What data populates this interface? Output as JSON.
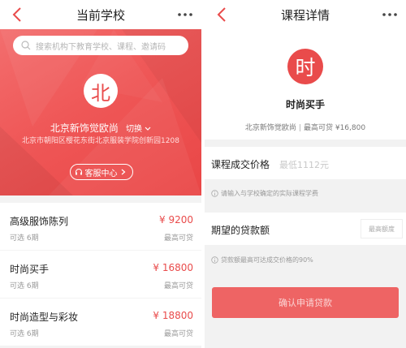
{
  "left": {
    "navbar": {
      "title": "当前学校",
      "back_icon": "chevron-left-icon",
      "more_icon": "more-horizontal-icon"
    },
    "search": {
      "placeholder": "搜索机构下教育学校、课程、邀请码"
    },
    "school": {
      "logo_char": "北",
      "name": "北京新饰觉欧尚",
      "switch_label": "切换",
      "address": "北京市朝阳区樱花东街北京服装学院创新园1208",
      "service_label": "客服中心"
    },
    "courses": [
      {
        "name": "高级服饰陈列",
        "price": "¥ 9200",
        "option": "可选 6期",
        "max_label": "最高可贷"
      },
      {
        "name": "时尚买手",
        "price": "¥ 16800",
        "option": "可选 6期",
        "max_label": "最高可贷"
      },
      {
        "name": "时尚造型与彩妆",
        "price": "¥ 18800",
        "option": "可选 6期",
        "max_label": "最高可贷"
      }
    ]
  },
  "right": {
    "navbar": {
      "title": "课程详情",
      "back_icon": "chevron-left-icon",
      "more_icon": "more-horizontal-icon"
    },
    "course": {
      "logo_char": "时",
      "name": "时尚买手",
      "school": "北京新饰觉欧尚",
      "max_loan": "最高可贷 ¥16,800"
    },
    "price_field": {
      "label": "课程成交价格",
      "placeholder": "最低1112元"
    },
    "price_hint": "请输入与学校确定的实际课程学费",
    "loan_field": {
      "label": "期望的贷款额",
      "button": "最高额度"
    },
    "loan_hint": "贷款额最高可达成交价格的90%",
    "submit_label": "确认申请贷款"
  },
  "colors": {
    "brand_red": "#e94b4b",
    "submit_bg": "#ee6464"
  }
}
